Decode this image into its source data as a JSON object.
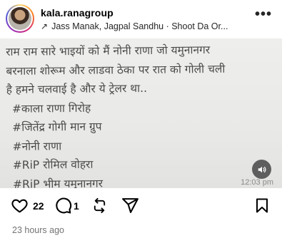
{
  "post": {
    "username": "kala.ranagroup",
    "audio": "Jass Manak, Jagpal Sandhu · Shoot Da Or...",
    "more_label": "•••",
    "media_lines": [
      "राम राम सारे भाइयों को मैं नोनी राणा जो यमुनानगर",
      "बरनाला शोरूम और लाडवा ठेका पर रात को गोली चली",
      "है हमने चलवाई है और ये ट्रेलर था..",
      "#काला राणा गिरोह",
      "#जितेंद्र गोगी मान ग्रुप",
      "#नोनी राणा",
      "#RiP रोमिल वोहरा",
      "#RiP भीम यमुनानगर"
    ],
    "media_timestamp": "12:03 pm",
    "likes": "22",
    "comments": "1",
    "time_ago": "23 hours ago"
  },
  "icons": {
    "audio": "arrow-up-right-icon",
    "like": "heart-icon",
    "comment": "comment-icon",
    "repost": "repost-icon",
    "share": "send-icon",
    "save": "bookmark-icon",
    "sound": "volume-icon"
  }
}
